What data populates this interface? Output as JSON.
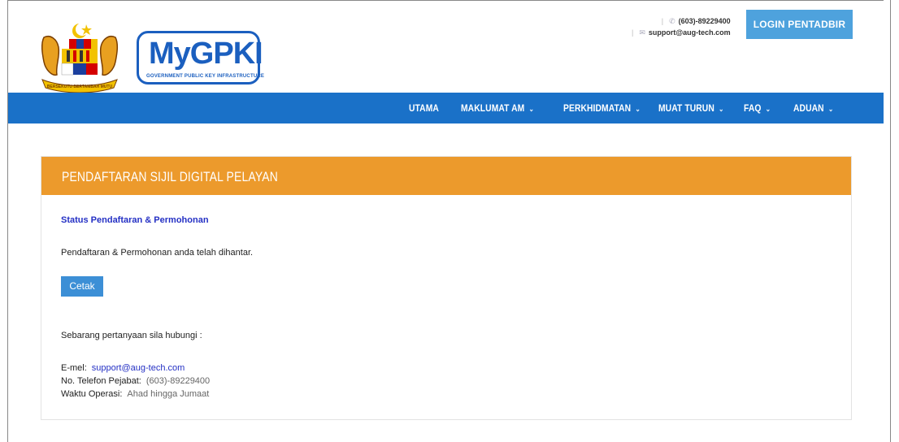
{
  "header": {
    "logo_brand": "MyGPKI",
    "logo_tagline": "GOVERNMENT PUBLIC KEY INFRASTRUCTURE",
    "crest_motto": "BERSEKUTU BERTAMBAH MUTU",
    "phone": "(603)-89229400",
    "email": "support@aug-tech.com",
    "login_label": "LOGIN PENTADBIR"
  },
  "nav": {
    "items": [
      {
        "label": "UTAMA",
        "has_dropdown": false
      },
      {
        "label": "MAKLUMAT AM",
        "has_dropdown": true
      },
      {
        "label": "PERKHIDMATAN",
        "has_dropdown": true
      },
      {
        "label": "MUAT TURUN",
        "has_dropdown": true
      },
      {
        "label": "FAQ",
        "has_dropdown": true
      },
      {
        "label": "ADUAN",
        "has_dropdown": true
      }
    ]
  },
  "panel": {
    "title": "PENDAFTARAN SIJIL DIGITAL PELAYAN",
    "status_title": "Status Pendaftaran & Permohonan",
    "message": "Pendaftaran & Permohonan anda telah dihantar.",
    "print_label": "Cetak",
    "inquiry_text": "Sebarang pertanyaan sila hubungi :",
    "email_label": "E-mel:",
    "email_value": "support@aug-tech.com",
    "phone_label": "No. Telefon Pejabat:",
    "phone_value": "(603)-89229400",
    "hours_label": "Waktu Operasi:",
    "hours_value": "Ahad hingga Jumaat"
  },
  "colors": {
    "nav_bg": "#1a71c8",
    "panel_header": "#ec9a2c",
    "login_button": "#4ea2dd",
    "print_button": "#3c8fd6",
    "link": "#2430c4"
  }
}
